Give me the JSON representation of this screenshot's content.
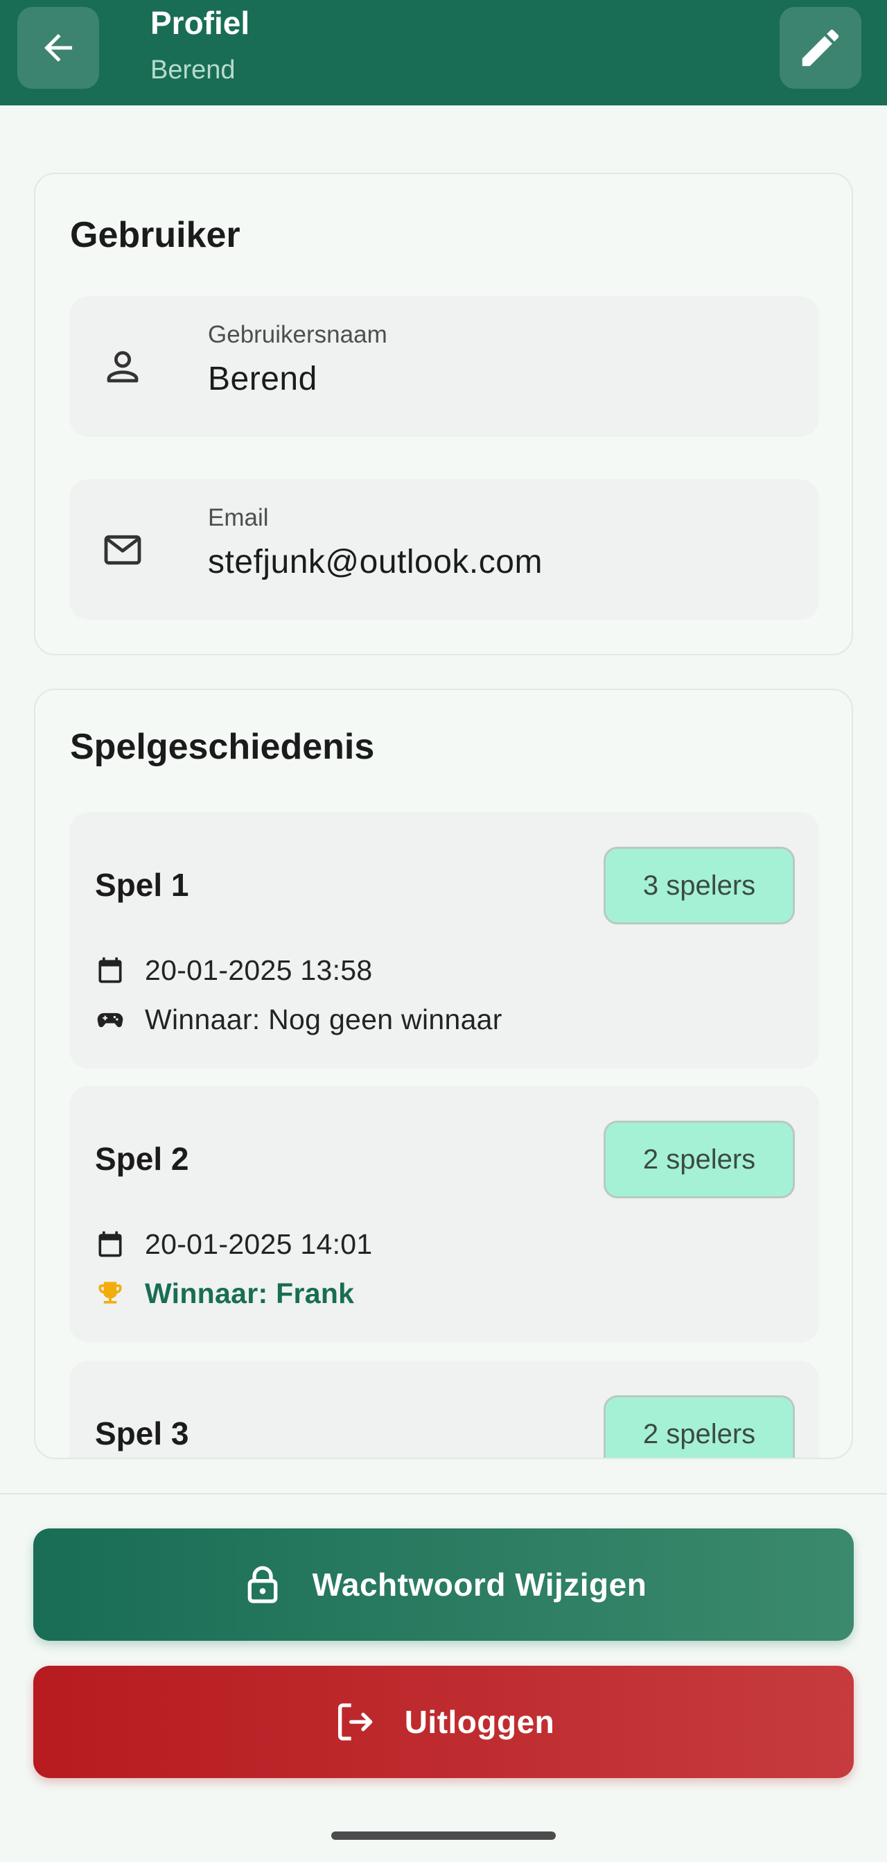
{
  "app_bar": {
    "title": "Profiel",
    "subtitle": "Berend",
    "back_icon": "arrow-left-icon",
    "edit_icon": "pencil-icon",
    "color": "#196d55"
  },
  "user_card": {
    "heading": "Gebruiker",
    "fields": [
      {
        "label": "Gebruikersnaam",
        "value": "Berend",
        "icon": "person-icon"
      },
      {
        "label": "Email",
        "value": "stefjunk@outlook.com",
        "icon": "mail-icon"
      }
    ]
  },
  "history_card": {
    "heading": "Spelgeschiedenis",
    "games": [
      {
        "title": "Spel 1",
        "players": "3 spelers",
        "date": "20-01-2025 13:58",
        "winner": "Winnaar: Nog geen winnaar",
        "winner_icon": "gamepad-icon"
      },
      {
        "title": "Spel 2",
        "players": "2 spelers",
        "date": "20-01-2025 14:01",
        "winner": "Winnaar: Frank",
        "winner_icon": "trophy-icon"
      },
      {
        "title": "Spel 3",
        "players": "2 spelers"
      }
    ]
  },
  "actions": {
    "change_password": "Wachtwoord Wijzigen",
    "logout": "Uitloggen"
  }
}
